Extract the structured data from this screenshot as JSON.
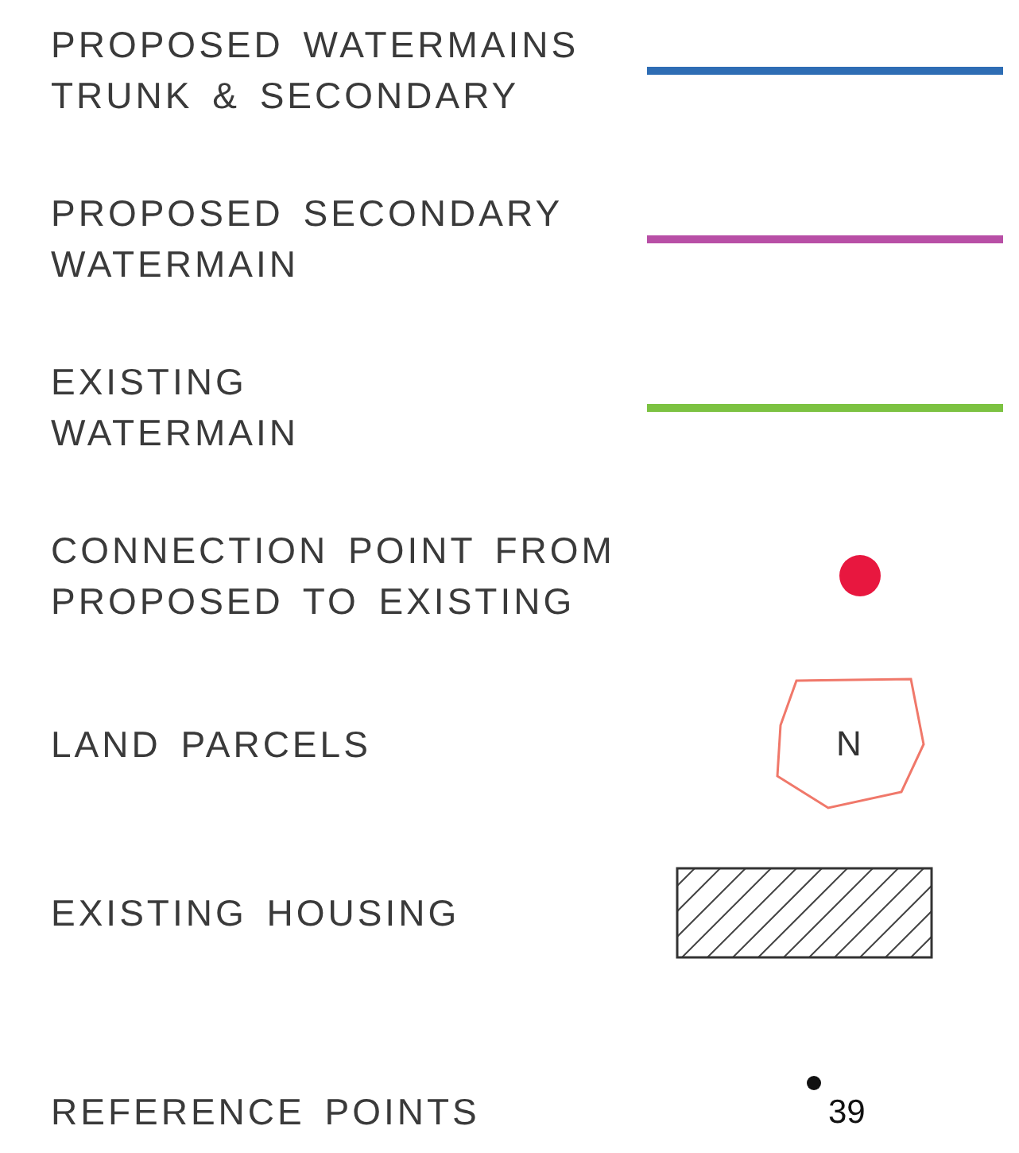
{
  "legend": [
    {
      "kind": "line",
      "label_lines": [
        "PROPOSED WATERMAINS",
        "TRUNK & SECONDARY"
      ],
      "color": "#2e6db4"
    },
    {
      "kind": "line",
      "label_lines": [
        "PROPOSED SECONDARY",
        "WATERMAIN"
      ],
      "color": "#b84fa6"
    },
    {
      "kind": "line",
      "label_lines": [
        "EXISTING",
        "WATERMAIN"
      ],
      "color": "#7cc242"
    },
    {
      "kind": "dot",
      "label_lines": [
        "CONNECTION POINT FROM",
        "PROPOSED TO EXISTING"
      ],
      "color": "#e8173f"
    },
    {
      "kind": "parcel",
      "label_lines": [
        "LAND PARCELS"
      ],
      "color": "#f0786a",
      "symbol_text": "N"
    },
    {
      "kind": "hatch",
      "label_lines": [
        "EXISTING HOUSING"
      ]
    },
    {
      "kind": "point",
      "label_lines": [
        "REFERENCE POINTS"
      ],
      "symbol_text": "39"
    }
  ]
}
